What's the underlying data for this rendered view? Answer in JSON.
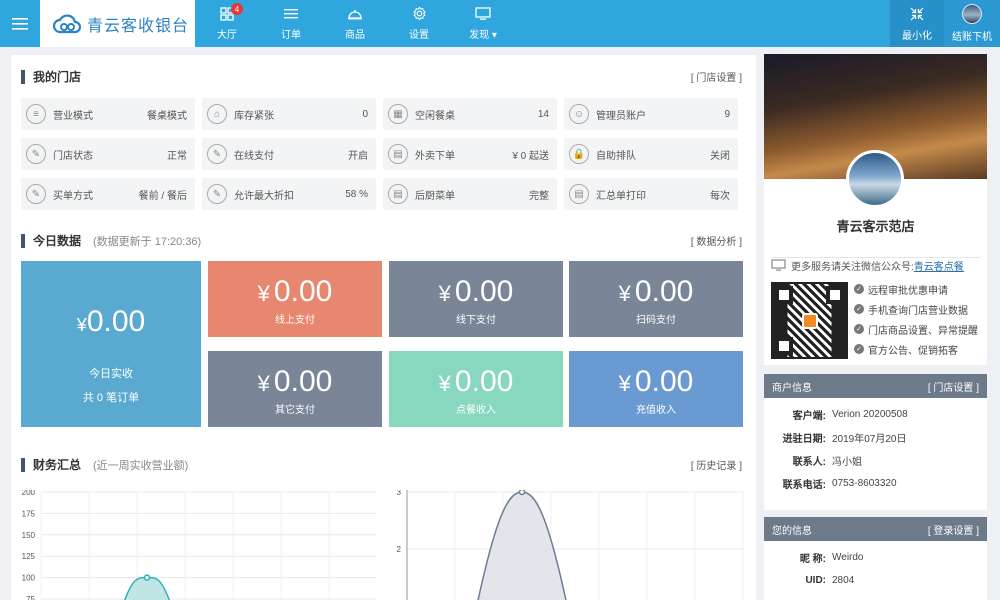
{
  "topbar": {
    "brand": "青云客收银台",
    "nav": [
      {
        "label": "大厅",
        "icon": "grid-icon",
        "badge": "4"
      },
      {
        "label": "订单",
        "icon": "list-icon"
      },
      {
        "label": "商品",
        "icon": "dish-cover-icon"
      },
      {
        "label": "设置",
        "icon": "gear-icon"
      },
      {
        "label": "发现",
        "icon": "monitor-icon"
      }
    ],
    "minimize_label": "最小化",
    "logout_label": "结账下机"
  },
  "store": {
    "title": "我的门店",
    "link": "[ 门店设置 ]",
    "items": [
      {
        "label": "营业模式",
        "value": "餐桌模式",
        "icon": "menu-lines-icon"
      },
      {
        "label": "库存紧张",
        "value": "0",
        "icon": "warehouse-icon"
      },
      {
        "label": "空闲餐桌",
        "value": "14",
        "icon": "table-grid-icon"
      },
      {
        "label": "管理员账户",
        "value": "9",
        "icon": "user-icon"
      },
      {
        "label": "门店状态",
        "value": "正常",
        "icon": "edit-icon"
      },
      {
        "label": "在线支付",
        "value": "开启",
        "icon": "edit-icon"
      },
      {
        "label": "外卖下单",
        "value": "¥ 0 起送",
        "icon": "doc-icon"
      },
      {
        "label": "自助排队",
        "value": "关闭",
        "icon": "lock-icon"
      },
      {
        "label": "买单方式",
        "value": "餐前 / 餐后",
        "icon": "edit-icon"
      },
      {
        "label": "允许最大折扣",
        "value": "58 %",
        "icon": "edit-icon"
      },
      {
        "label": "后厨菜单",
        "value": "完整",
        "icon": "doc-icon"
      },
      {
        "label": "汇总单打印",
        "value": "每次",
        "icon": "doc-icon"
      }
    ]
  },
  "today": {
    "title": "今日数据",
    "subtitle": "(数据更新于 17:20:36)",
    "link": "[ 数据分析 ]",
    "currency": "¥",
    "big": {
      "amount": "0.00",
      "line1": "今日实收",
      "line2": "共 0 笔订单"
    },
    "tiles": [
      {
        "amount": "0.00",
        "label": "线上支付",
        "color": "#e8876f"
      },
      {
        "amount": "0.00",
        "label": "线下支付",
        "color": "#7a8598"
      },
      {
        "amount": "0.00",
        "label": "扫码支付",
        "color": "#7a8598"
      },
      {
        "amount": "0.00",
        "label": "其它支付",
        "color": "#7a8598"
      },
      {
        "amount": "0.00",
        "label": "点餐收入",
        "color": "#88d8bf"
      },
      {
        "amount": "0.00",
        "label": "充值收入",
        "color": "#6a9ad2"
      }
    ],
    "big_color": "#5aa9d1"
  },
  "finance": {
    "title": "财务汇总",
    "subtitle": "(近一周实收营业额)",
    "link": "[ 历史记录 ]"
  },
  "chart_data": [
    {
      "type": "area",
      "yticks": [
        "200",
        "175",
        "150",
        "125",
        "100",
        "75"
      ],
      "ylim": [
        75,
        200
      ],
      "peak_value": 100
    },
    {
      "type": "area",
      "yticks": [
        "3",
        "2"
      ],
      "ylim": [
        1.5,
        3
      ],
      "peak_value": 3
    }
  ],
  "side": {
    "store_name": "青云客示范店",
    "promo_text": "更多服务请关注微信公众号:",
    "promo_link": "青云客点餐",
    "features": [
      "远程审批优惠申请",
      "手机查询门店营业数据",
      "门店商品设置、异常提醒",
      "官方公告、促销拓客"
    ],
    "merchant": {
      "title": "商户信息",
      "link": "[ 门店设置 ]",
      "rows": [
        {
          "k": "客户端:",
          "v": "Verion 20200508"
        },
        {
          "k": "进驻日期:",
          "v": "2019年07月20日"
        },
        {
          "k": "联系人:",
          "v": "冯小姐"
        },
        {
          "k": "联系电话:",
          "v": "0753-8603320"
        }
      ]
    },
    "mine": {
      "title": "您的信息",
      "link": "[ 登录设置 ]",
      "rows": [
        {
          "k": "昵 称:",
          "v": "Weirdo"
        },
        {
          "k": "UID:",
          "v": "2804"
        }
      ]
    }
  }
}
